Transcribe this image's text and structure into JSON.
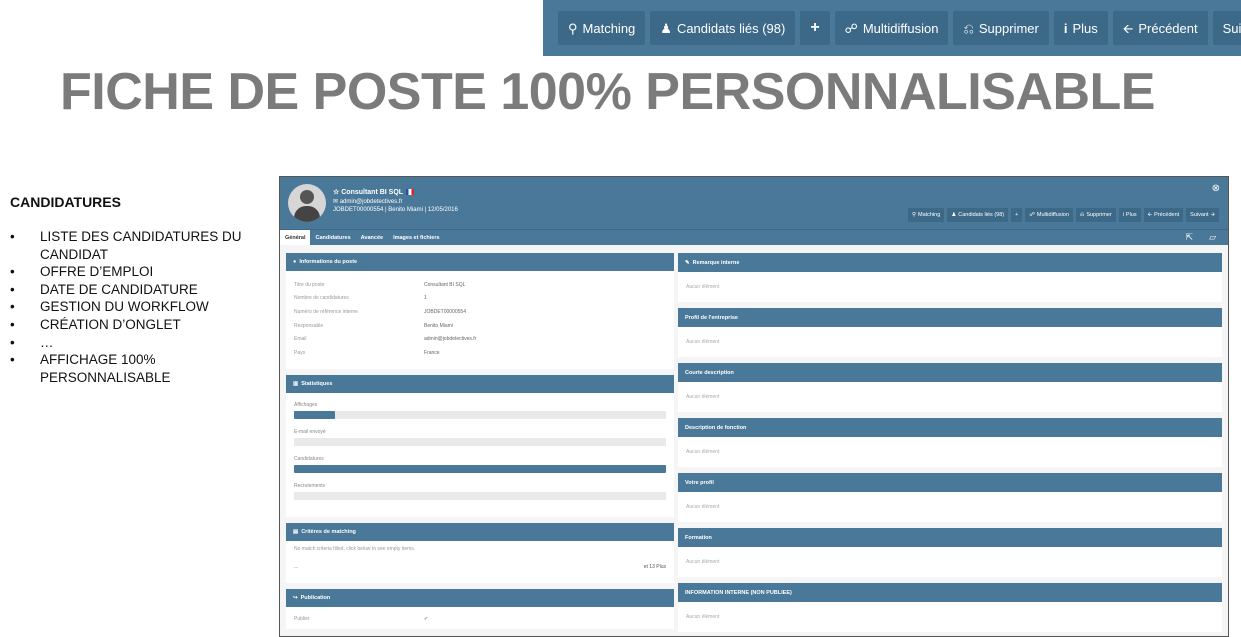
{
  "toolbar": {
    "buttons": [
      {
        "label": "Matching",
        "icon": "search-icon",
        "glyph": "🔍︎"
      },
      {
        "label": "Candidats liés (98)",
        "icon": "users-icon",
        "glyph": "👥︎"
      },
      {
        "label": "+",
        "icon": "plus-icon",
        "glyph": ""
      },
      {
        "label": "Multidiffusion",
        "icon": "share-icon",
        "glyph": "⋖"
      },
      {
        "label": "Supprimer",
        "icon": "trash-icon",
        "glyph": "🗑︎"
      },
      {
        "label": "Plus",
        "icon": "info-icon",
        "glyph": "ℹ"
      },
      {
        "label": "Précédent",
        "icon": "arrow-left-icon",
        "glyph": "🡐"
      },
      {
        "label": "Suivant",
        "icon": "arrow-right-icon",
        "glyph": "🡒"
      }
    ]
  },
  "title": "FICHE DE POSTE 100% PERSONNALISABLE",
  "left": {
    "heading": "CANDIDATURES",
    "items": [
      "LISTE DES CANDIDATURES DU CANDIDAT",
      "OFFRE D’EMPLOI",
      "DATE DE CANDIDATURE",
      "GESTION DU WORKFLOW",
      "CRÉATION D’ONGLET",
      "…",
      "AFFICHAGE 100% PERSONNALISABLE"
    ]
  },
  "app": {
    "job_title": "Consultant BI SQL",
    "email": "admin@jobdetectives.fr",
    "reference_line": "JOBDET00000554 | Benito Miami | 12/05/2016",
    "mini_buttons": [
      "Matching",
      "Candidats liés (98)",
      "+",
      "Multidiffusion",
      "Supprimer",
      "Plus",
      "Précédent",
      "Suivant"
    ],
    "tabs": [
      "Général",
      "Candidatures",
      "Avancée",
      "Images et fichiers"
    ],
    "info_panel": {
      "title": "Informations du poste",
      "rows": [
        {
          "k": "Titre du poste",
          "v": "Consultant BI SQL"
        },
        {
          "k": "Nombre de candidatures",
          "v": "1"
        },
        {
          "k": "Numéro de référence interne",
          "v": "JOBDET00000554"
        },
        {
          "k": "Responsable",
          "v": "Benito Miami"
        },
        {
          "k": "Email",
          "v": "admin@jobdetectives.fr"
        },
        {
          "k": "Pays",
          "v": "France"
        }
      ]
    },
    "stats_panel": {
      "title": "Statistiques",
      "items": [
        {
          "label": "Affichages",
          "fraction": 0.11
        },
        {
          "label": "E-mail envoyé",
          "fraction": 0
        },
        {
          "label": "Candidatures",
          "fraction": 1
        },
        {
          "label": "Recrutements",
          "fraction": 0
        }
      ]
    },
    "matching_panel": {
      "title": "Critères de matching",
      "text": "No match criteria filled, click below to see empty items.",
      "left_foot": "...",
      "right_foot": "et 13 Plus"
    },
    "publication_panel": {
      "title": "Publication",
      "row_label": "Publier",
      "row_value": "✔"
    },
    "right_panels": [
      "Remarque interne",
      "Profil de l'entreprise",
      "Courte description",
      "Description de fonction",
      "Votre profil",
      "Formation",
      "INFORMATION INTERNE (NON PUBLIEE)"
    ],
    "empty_text": "Aucun élément"
  }
}
